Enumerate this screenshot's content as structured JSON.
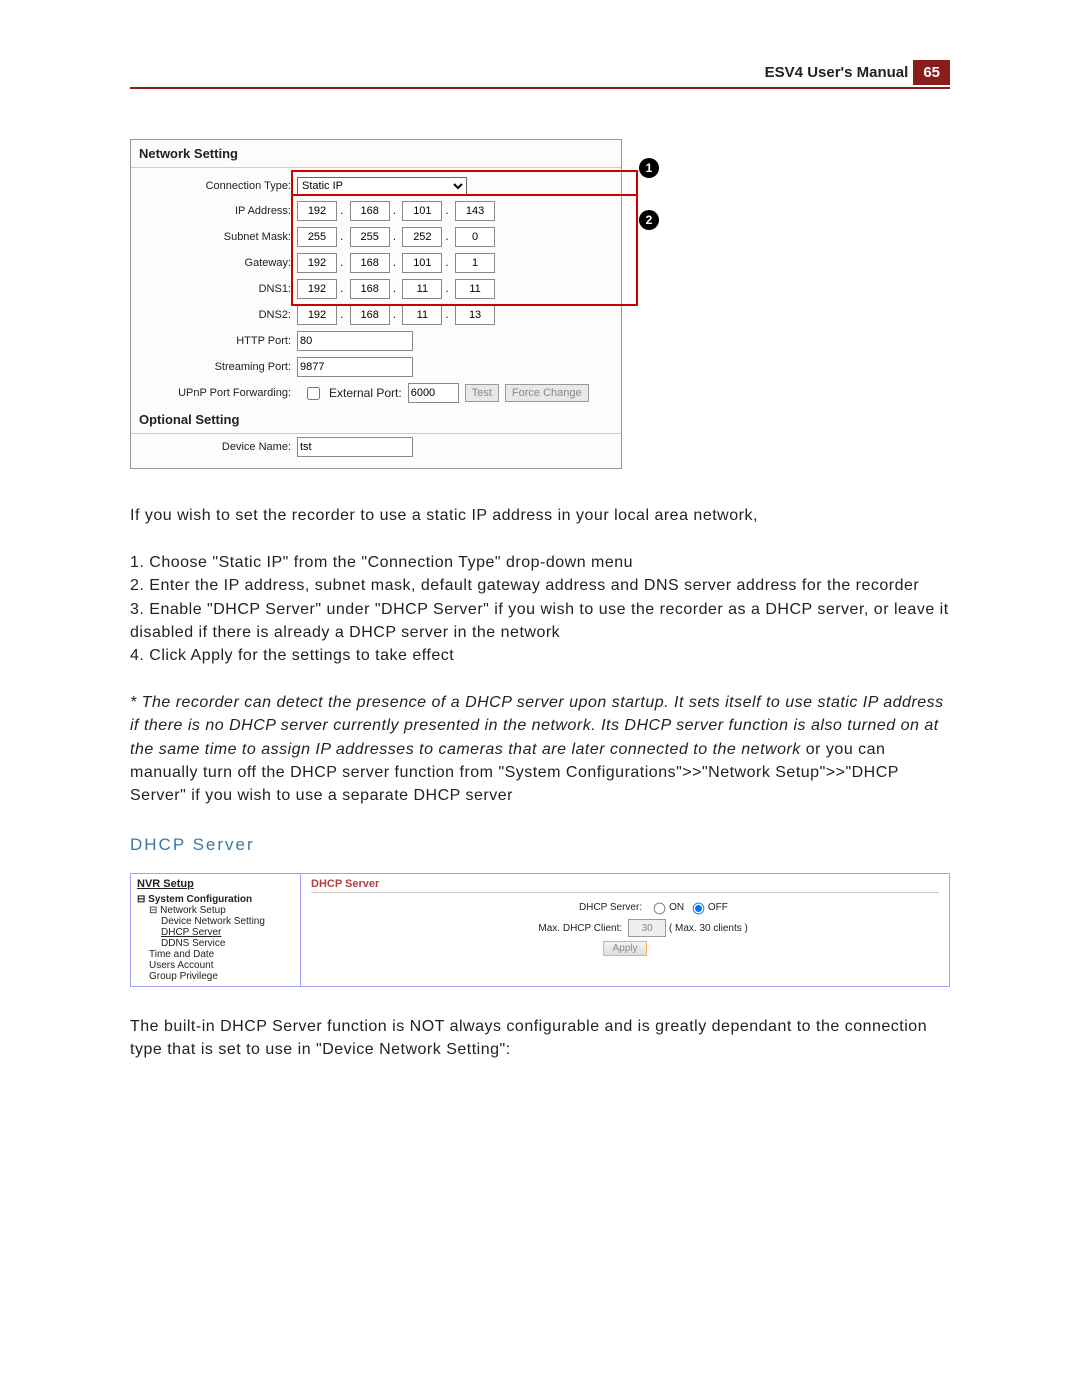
{
  "header": {
    "title": "ESV4 User's Manual",
    "page_number": "65"
  },
  "panel1": {
    "title": "Network Setting",
    "connection_type": {
      "label": "Connection Type:",
      "selected": "Static IP"
    },
    "ip_address": {
      "label": "IP Address:",
      "octets": [
        "192",
        "168",
        "101",
        "143"
      ]
    },
    "subnet_mask": {
      "label": "Subnet Mask:",
      "octets": [
        "255",
        "255",
        "252",
        "0"
      ]
    },
    "gateway": {
      "label": "Gateway:",
      "octets": [
        "192",
        "168",
        "101",
        "1"
      ]
    },
    "dns1": {
      "label": "DNS1:",
      "octets": [
        "192",
        "168",
        "11",
        "11"
      ]
    },
    "dns2": {
      "label": "DNS2:",
      "octets": [
        "192",
        "168",
        "11",
        "13"
      ]
    },
    "http_port": {
      "label": "HTTP Port:",
      "value": "80"
    },
    "streaming_port": {
      "label": "Streaming Port:",
      "value": "9877"
    },
    "upnp": {
      "label": "UPnP Port Forwarding:",
      "external_label": "External Port:",
      "external_value": "6000",
      "test_label": "Test",
      "force_label": "Force Change"
    },
    "optional_title": "Optional Setting",
    "device_name": {
      "label": "Device Name:",
      "value": "tst"
    },
    "callouts": {
      "one": "1",
      "two": "2"
    }
  },
  "body1": {
    "intro": "If you wish to set the recorder to use a static IP address in your local area network,",
    "step1": "1. Choose \"Static IP\" from the \"Connection Type\" drop-down menu",
    "step2": "2. Enter the IP address, subnet mask, default gateway address and DNS server address for the recorder",
    "step3": "3. Enable \"DHCP Server\" under \"DHCP Server\" if you wish to use the recorder as a DHCP server, or leave it disabled if there is already a DHCP server in the network",
    "step4": "4. Click Apply for the settings to take effect",
    "note_ital": "* The recorder can detect the presence of a DHCP server upon startup. It sets itself to use static IP address if there is no DHCP server currently presented in the network. Its DHCP server function is also turned on at the same time to assign IP addresses to cameras that are later connected to the network",
    "note_roman": " or you can manually turn off the DHCP server function from \"System Configurations\">>\"Network Setup\">>\"DHCP Server\" if you wish to use a separate DHCP server"
  },
  "section_heading": "DHCP Server",
  "panel2": {
    "side": {
      "root": "NVR Setup",
      "system_conf": "System Configuration",
      "network_setup": "Network Setup",
      "items": {
        "device_network": "Device Network Setting",
        "dhcp_server": "DHCP Server",
        "ddns": "DDNS Service",
        "time_date": "Time and Date",
        "users": "Users Account",
        "group_priv": "Group Privilege"
      },
      "box_minus": "⊟"
    },
    "main": {
      "title": "DHCP Server",
      "dhcp_server_label": "DHCP Server:",
      "on_label": "ON",
      "off_label": "OFF",
      "max_client_label": "Max. DHCP Client:",
      "max_client_value": "30",
      "max_client_hint": "( Max. 30 clients )",
      "apply_label": "Apply"
    }
  },
  "body2": {
    "para": "The built-in DHCP Server function is NOT always configurable and is greatly dependant to the connection type that is set to use in \"Device Network Setting\":"
  }
}
